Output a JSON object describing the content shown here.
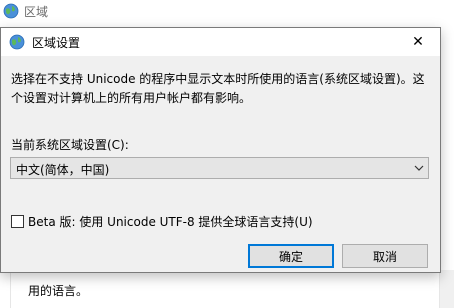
{
  "background_window": {
    "title": "区域",
    "bottom_text": "用的语言。"
  },
  "dialog": {
    "title": "区域设置",
    "close_glyph": "✕",
    "description": "选择在不支持 Unicode 的程序中显示文本时所使用的语言(系统区域设置)。这个设置对计算机上的所有用户帐户都有影响。",
    "current_locale_label": "当前系统区域设置(C):",
    "current_locale_value": "中文(简体，中国)",
    "beta_checkbox": {
      "label": "Beta 版: 使用 Unicode UTF-8 提供全球语言支持(U)",
      "checked": false
    },
    "ok_label": "确定",
    "cancel_label": "取消"
  },
  "icons": {
    "window": "globe-icon",
    "dropdown": "chevron-down-icon"
  },
  "colors": {
    "dialog_bg": "#f0f0f0",
    "default_button_border": "#0078d7",
    "dropdown_bg": "#e5e5e5"
  }
}
